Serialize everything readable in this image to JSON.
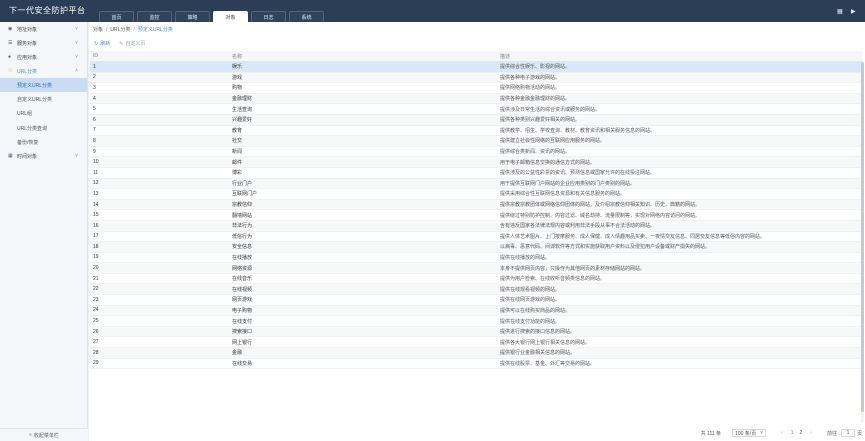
{
  "app_title": "下一代安全防护平台",
  "tabs": [
    "首页",
    "监控",
    "策略",
    "对象",
    "日志",
    "系统"
  ],
  "active_tab_index": 3,
  "sidebar": {
    "items": [
      {
        "label": "地址对象",
        "icon": "location-icon"
      },
      {
        "label": "服务对象",
        "icon": "list-icon"
      },
      {
        "label": "应用对象",
        "icon": "app-icon"
      },
      {
        "label": "URL分类",
        "icon": "url-icon",
        "expanded": true,
        "children": [
          "预定义URL分类",
          "自定义URL分类",
          "URL组",
          "URL分类查询",
          "备份/恢复"
        ]
      },
      {
        "label": "时间对象",
        "icon": "calendar-icon"
      }
    ],
    "active_child": "预定义URL分类",
    "collapse_label": "收起菜单栏"
  },
  "breadcrumb": [
    "对象",
    "URL分类",
    "预定义URL分类"
  ],
  "toolbar": {
    "refresh_label": "刷新",
    "customize_label": "自定义页"
  },
  "table": {
    "headers": {
      "id": "ID",
      "name": "名称",
      "desc": "描述"
    },
    "rows": [
      {
        "id": "1",
        "name": "娱乐",
        "desc": "提供综合性娱乐、影视的网站。"
      },
      {
        "id": "2",
        "name": "游戏",
        "desc": "提供各种电子游戏的网站。"
      },
      {
        "id": "3",
        "name": "购物",
        "desc": "提供网络购物活动的网站。"
      },
      {
        "id": "4",
        "name": "金融理财",
        "desc": "提供各种金融金融理财的网站。"
      },
      {
        "id": "5",
        "name": "生活查询",
        "desc": "提供涉及日常生活的综合资讯或服务的网站。"
      },
      {
        "id": "6",
        "name": "兴趣爱好",
        "desc": "提供各种类别兴趣爱好相关的网站。"
      },
      {
        "id": "7",
        "name": "教育",
        "desc": "提供教学、招生、学校查询、教材、教育资讯和相关服务信息的网站。"
      },
      {
        "id": "8",
        "name": "社交",
        "desc": "提供建立社会性网络的互联网应用服务的网站。"
      },
      {
        "id": "9",
        "name": "新闻",
        "desc": "提供综合类新闻、资讯的网站。"
      },
      {
        "id": "10",
        "name": "邮件",
        "desc": "用于电子邮箱信息交换的通信方式的网站。"
      },
      {
        "id": "11",
        "name": "博彩",
        "desc": "提供涉及的公益性彩票的资讯、预测信息或国家允许的在线投注网站。"
      },
      {
        "id": "12",
        "name": "行业门户",
        "desc": "用于提供互联网门户网站的企业应用类别的门户类别的网站。"
      },
      {
        "id": "13",
        "name": "互联网门户",
        "desc": "提供采用综合性互联网信息资源和有关信息服务的网站。"
      },
      {
        "id": "14",
        "name": "宗教信仰",
        "desc": "提供宗教宗教团体或网络信仰团体的网站，及介绍宗教信仰相关知识、历史、典籍的网站。"
      },
      {
        "id": "15",
        "name": "翻墙网站",
        "desc": "提供绕过特别防护控制、内容过滤、域名劫持、流量限制等，实现对网络内容访问的网站。"
      },
      {
        "id": "16",
        "name": "非法行为",
        "desc": "含有违反国家各法律法规内容或利用非法手段从事不合法活动的网站。"
      },
      {
        "id": "17",
        "name": "低俗行为",
        "desc": "提供人体艺术图片、上门按摩服务、成人保健、成人情趣用品买卖、一夜情交友信息、同居交友信息等低俗内容的网站。"
      },
      {
        "id": "18",
        "name": "安全信息",
        "desc": "以病毒、恶意代码、间谍软件等方式和实施获取用户资料以及侵犯用户设备或财产损失的网站。"
      },
      {
        "id": "19",
        "name": "在线播放",
        "desc": "提供在线播放的网站。"
      },
      {
        "id": "20",
        "name": "网络资源",
        "desc": "本身不提供网页内容，只操作为其他网页的素材存储网站的网站。"
      },
      {
        "id": "21",
        "name": "在线音乐",
        "desc": "提供为用户检索、在线收听音频类信息的网站。"
      },
      {
        "id": "22",
        "name": "在线视频",
        "desc": "提供在线观看视频的网站。"
      },
      {
        "id": "23",
        "name": "网页游戏",
        "desc": "提供在线网页游戏的网站。"
      },
      {
        "id": "24",
        "name": "电子购物",
        "desc": "提供可以在线购买商品的网站。"
      },
      {
        "id": "25",
        "name": "在线支付",
        "desc": "提供在线支付功能的网站。"
      },
      {
        "id": "26",
        "name": "搜索接口",
        "desc": "提供进行搜索的接口信息的网站。"
      },
      {
        "id": "27",
        "name": "网上银行",
        "desc": "提供各大银行网上银行相关信息的网站。"
      },
      {
        "id": "28",
        "name": "金融",
        "desc": "提供银行业金融相关信息的网站。"
      },
      {
        "id": "29",
        "name": "在线交易",
        "desc": "提供在线股票、基金、外汇等交易的网站。"
      }
    ]
  },
  "pager": {
    "total": "共 111 条",
    "page_size": "100 条/页",
    "pages": [
      "1",
      "2"
    ],
    "active_page": "1",
    "goto_label": "前往",
    "goto_value": "1",
    "page_unit": "页"
  }
}
